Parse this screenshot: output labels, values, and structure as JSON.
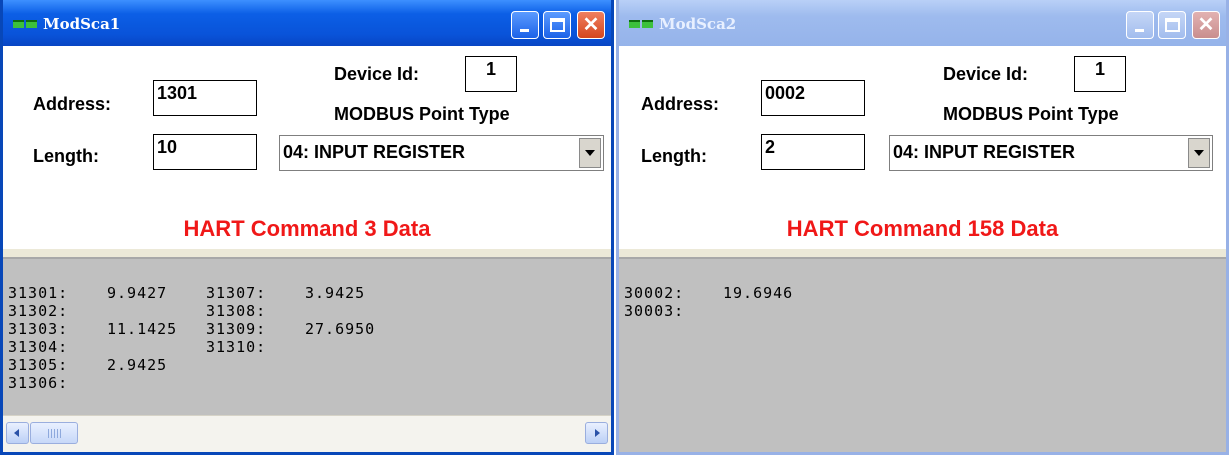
{
  "windows": [
    {
      "title": "ModSca1",
      "address_label": "Address:",
      "address": "1301",
      "length_label": "Length:",
      "length": "10",
      "device_id_label": "Device Id:",
      "device_id": "1",
      "point_type_label": "MODBUS Point Type",
      "point_type": "04: INPUT REGISTER",
      "caption": "HART Command 3 Data",
      "rows": [
        {
          "a": "31301:",
          "av": "9.9427",
          "b": "31307:",
          "bv": "3.9425"
        },
        {
          "a": "31302:",
          "av": "",
          "b": "31308:",
          "bv": ""
        },
        {
          "a": "31303:",
          "av": "11.1425",
          "b": "31309:",
          "bv": "27.6950"
        },
        {
          "a": "31304:",
          "av": "",
          "b": "31310:",
          "bv": ""
        },
        {
          "a": "31305:",
          "av": "2.9425",
          "b": "",
          "bv": ""
        },
        {
          "a": "31306:",
          "av": "",
          "b": "",
          "bv": ""
        }
      ]
    },
    {
      "title": "ModSca2",
      "address_label": "Address:",
      "address": "0002",
      "length_label": "Length:",
      "length": "2",
      "device_id_label": "Device Id:",
      "device_id": "1",
      "point_type_label": "MODBUS Point Type",
      "point_type": "04: INPUT REGISTER",
      "caption": "HART Command 158 Data",
      "rows": [
        {
          "a": "30002:",
          "av": "19.6946",
          "b": "",
          "bv": ""
        },
        {
          "a": "30003:",
          "av": "",
          "b": "",
          "bv": ""
        }
      ]
    }
  ],
  "colors": {
    "active_titlebar": "#0a5ee0",
    "inactive_titlebar": "#9db8e9",
    "caption_red": "#f01818",
    "data_background": "#c0c0c0"
  },
  "icons": {
    "minimize": "minimize-icon",
    "maximize": "maximize-icon",
    "close": "close-icon",
    "dropdown": "chevron-down-icon"
  }
}
